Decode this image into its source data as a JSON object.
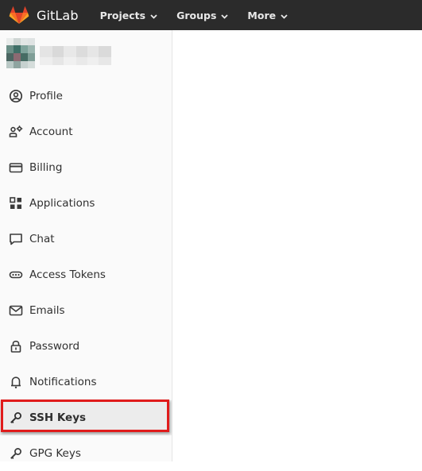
{
  "header": {
    "brand": "GitLab",
    "nav": [
      {
        "label": "Projects",
        "icon": "chevron-down-icon"
      },
      {
        "label": "Groups",
        "icon": "chevron-down-icon"
      },
      {
        "label": "More",
        "icon": "chevron-down-icon"
      }
    ]
  },
  "sidebar": {
    "items": [
      {
        "label": "Profile",
        "icon": "profile-icon"
      },
      {
        "label": "Account",
        "icon": "account-icon"
      },
      {
        "label": "Billing",
        "icon": "billing-icon"
      },
      {
        "label": "Applications",
        "icon": "applications-icon"
      },
      {
        "label": "Chat",
        "icon": "chat-icon"
      },
      {
        "label": "Access Tokens",
        "icon": "token-icon"
      },
      {
        "label": "Emails",
        "icon": "email-icon"
      },
      {
        "label": "Password",
        "icon": "lock-icon"
      },
      {
        "label": "Notifications",
        "icon": "bell-icon"
      },
      {
        "label": "SSH Keys",
        "icon": "key-icon",
        "active": true
      },
      {
        "label": "GPG Keys",
        "icon": "key-icon"
      }
    ]
  },
  "colors": {
    "topbar": "#2b2b2b",
    "highlight": "#e01b1b",
    "sidebar_bg": "#fafafa"
  }
}
